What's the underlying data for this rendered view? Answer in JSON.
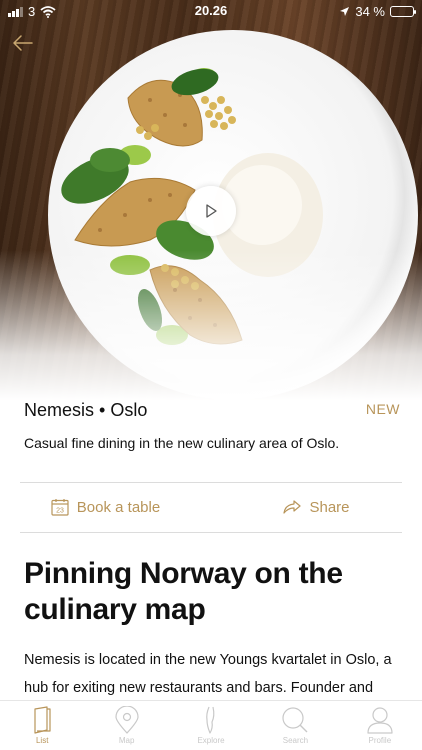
{
  "status_bar": {
    "carrier": "3",
    "time": "20.26",
    "battery": "34 %",
    "battery_level": 0.34
  },
  "hero": {
    "image": "plated-dish-photo",
    "back_icon": "back-arrow-icon",
    "play_icon": "play-icon"
  },
  "restaurant": {
    "name": "Nemesis • Oslo",
    "badge": "NEW",
    "tagline": "Casual fine dining in the new culinary area of Oslo."
  },
  "actions": {
    "book_label": "Book a table",
    "book_icon": "calendar-icon",
    "calendar_day": "23",
    "share_label": "Share",
    "share_icon": "share-arrow-icon"
  },
  "article": {
    "headline": "Pinning Norway on the culinary map",
    "body": "Nemesis is located in the new Youngs kvartalet in Oslo, a hub for exiting new restaurants and bars. Founder and"
  },
  "tabbar": {
    "items": [
      {
        "label": "List",
        "icon": "book-icon",
        "active": true
      },
      {
        "label": "Map",
        "icon": "map-pin-icon",
        "active": false
      },
      {
        "label": "Explore",
        "icon": "explore-icon",
        "active": false
      },
      {
        "label": "Search",
        "icon": "search-icon",
        "active": false
      },
      {
        "label": "Profile",
        "icon": "profile-icon",
        "active": false
      }
    ]
  },
  "colors": {
    "accent": "#b8955a",
    "inactive": "#c9c9c9"
  }
}
